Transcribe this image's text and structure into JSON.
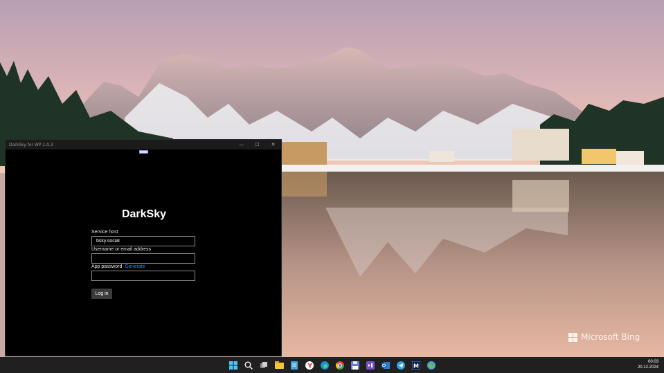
{
  "window": {
    "title": "DarkSky for WP 1.0.3",
    "controls": {
      "minimize": "—",
      "maximize": "☐",
      "close": "✕"
    }
  },
  "login": {
    "app_title": "DarkSky",
    "service_host_label": "Service host",
    "service_host_value": "bsky.social",
    "username_label": "Username or email address",
    "username_value": "",
    "password_label": "App password",
    "generate_link": "Generate",
    "password_value": "",
    "login_button": "Log in"
  },
  "desktop": {
    "watermark": "Microsoft Bing"
  },
  "taskbar": {
    "icons": [
      "windows-start-icon",
      "search-icon",
      "task-view-icon",
      "file-explorer-icon",
      "notepad-icon",
      "yandex-browser-icon",
      "edge-icon",
      "chrome-icon",
      "save-disk-icon",
      "visual-studio-icon",
      "outlook-icon",
      "telegram-icon",
      "app-m-icon",
      "globe-icon"
    ],
    "time": "00:03",
    "date": "20.12.2024"
  },
  "colors": {
    "window_bg": "#000000",
    "titlebar_bg": "#1b1b1b",
    "link": "#3b82f6",
    "button_bg": "#3b3b3b",
    "taskbar_bg": "#202020"
  }
}
